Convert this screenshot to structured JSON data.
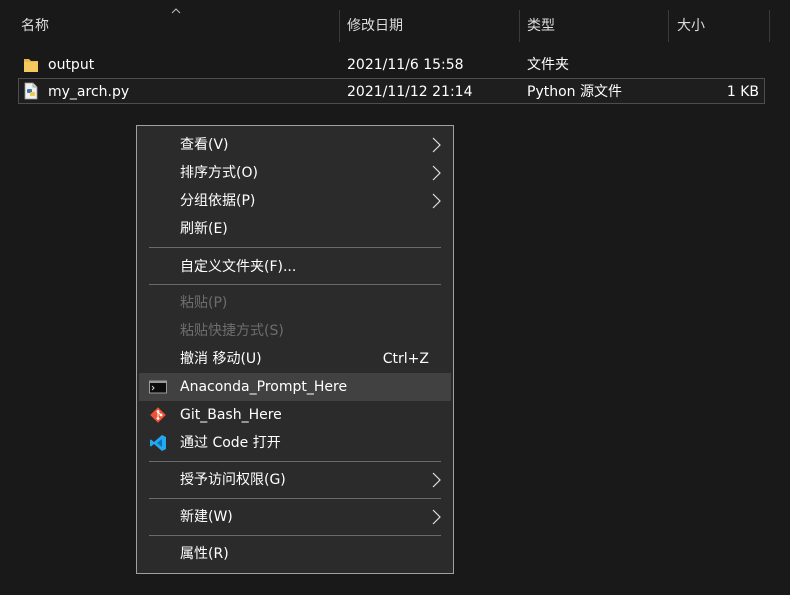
{
  "columns": [
    {
      "label": "名称"
    },
    {
      "label": "修改日期"
    },
    {
      "label": "类型"
    },
    {
      "label": "大小"
    }
  ],
  "files": [
    {
      "name": "output",
      "modified": "2021/11/6 15:58",
      "type": "文件夹",
      "size": "",
      "icon": "folder-icon",
      "selected": false
    },
    {
      "name": "my_arch.py",
      "modified": "2021/11/12 21:14",
      "type": "Python 源文件",
      "size": "1 KB",
      "icon": "python-file-icon",
      "selected": true
    }
  ],
  "context_menu": {
    "view": "查看(V)",
    "sort_by": "排序方式(O)",
    "group_by": "分组依据(P)",
    "refresh": "刷新(E)",
    "customize_folder": "自定义文件夹(F)...",
    "paste": "粘贴(P)",
    "paste_shortcut": "粘贴快捷方式(S)",
    "undo_move": "撤消 移动(U)",
    "undo_shortcut": "Ctrl+Z",
    "anaconda_prompt": "Anaconda_Prompt_Here",
    "git_bash": "Git_Bash_Here",
    "open_with_code": "通过 Code 打开",
    "grant_access": "授予访问权限(G)",
    "new": "新建(W)",
    "properties": "属性(R)"
  },
  "colors": {
    "background": "#191919",
    "menu_background": "#2b2b2b",
    "hover": "#414141",
    "disabled_text": "#6d6d6d",
    "folder": "#e8b64b",
    "vscode_blue": "#23a9f2",
    "git_orange": "#f05133"
  }
}
